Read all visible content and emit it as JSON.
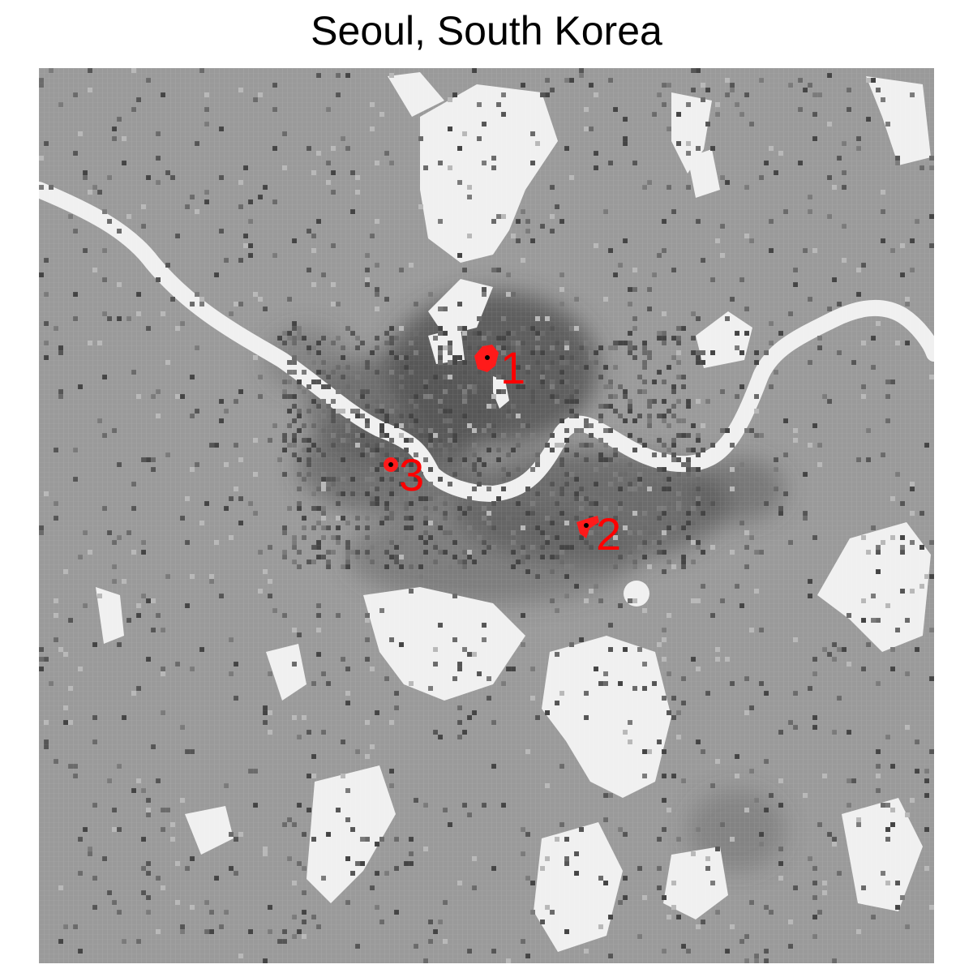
{
  "title": "Seoul, South Korea",
  "colors": {
    "background_land": "#9a9a9a",
    "open_land": "#f0f0f0",
    "river": "#f0f0f0",
    "dense_urban": "#5a5a5a",
    "marker": "#ff0000",
    "marker_center": "#000000"
  },
  "markers": [
    {
      "id": 1,
      "label": "1"
    },
    {
      "id": 2,
      "label": "2"
    },
    {
      "id": 3,
      "label": "3"
    }
  ]
}
